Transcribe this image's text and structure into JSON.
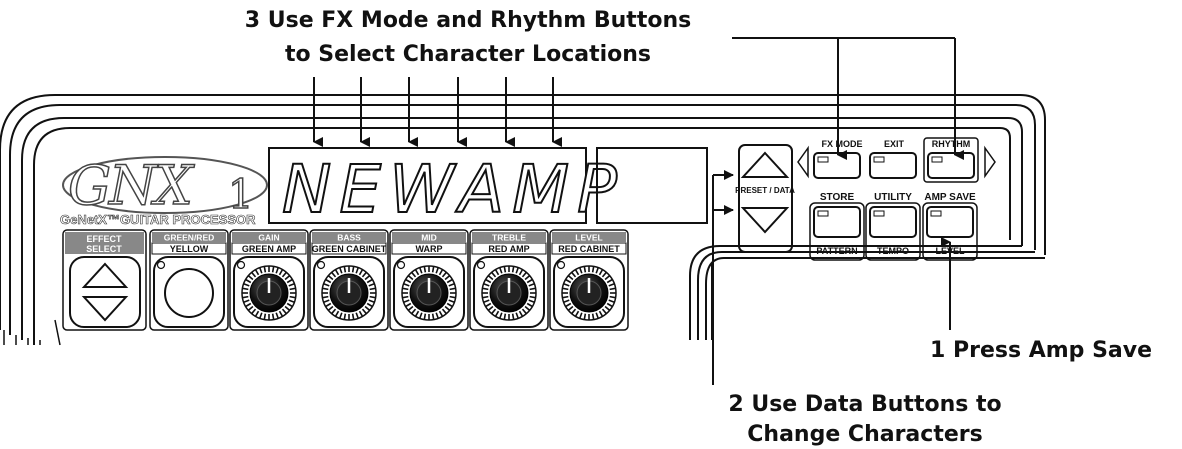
{
  "callouts": {
    "step3_line1": "3 Use FX Mode and Rhythm Buttons",
    "step3_line2": "to Select Character Locations",
    "step1": "1 Press Amp Save",
    "step2_line1": "2 Use Data Buttons to",
    "step2_line2": "Change Characters"
  },
  "device": {
    "logo": "GNX1",
    "subtitle": "GeNetX™GUITAR PROCESSOR",
    "display_text": "NEWAMP",
    "preset_data_label": "PRESET / DATA",
    "effect_select": {
      "line1": "EFFECT",
      "line2": "SELECT"
    },
    "knob_sections": [
      {
        "top": "GREEN/RED",
        "bottom": "YELLOW"
      },
      {
        "top": "GAIN",
        "bottom": "GREEN AMP"
      },
      {
        "top": "BASS",
        "bottom": "GREEN CABINET"
      },
      {
        "top": "MID",
        "bottom": "WARP"
      },
      {
        "top": "TREBLE",
        "bottom": "RED AMP"
      },
      {
        "top": "LEVEL",
        "bottom": "RED CABINET"
      }
    ],
    "buttons": {
      "fx_mode": "FX MODE",
      "exit": "EXIT",
      "rhythm": "RHYTHM",
      "store": "STORE",
      "pattern": "PATTERN",
      "utility": "UTILITY",
      "tempo": "TEMPO",
      "amp_save": "AMP SAVE",
      "level": "LEVEL"
    }
  }
}
